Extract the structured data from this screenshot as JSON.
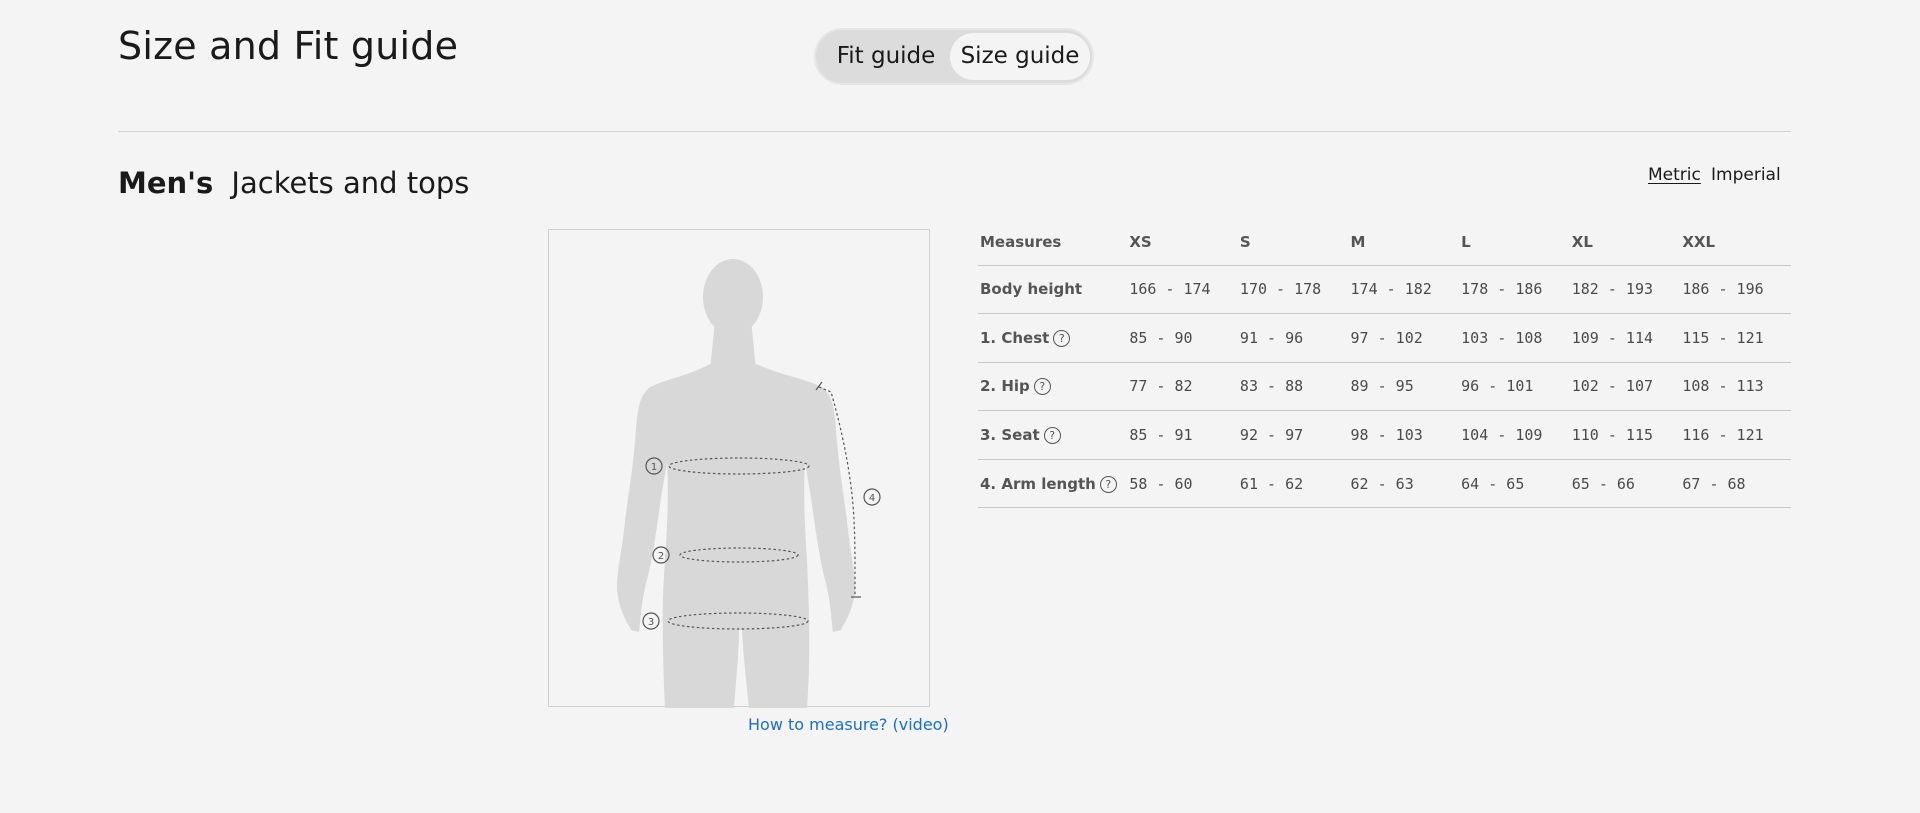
{
  "header": {
    "title": "Size and Fit guide"
  },
  "toggle": {
    "fit_label": "Fit guide",
    "size_label": "Size guide",
    "selected": "Size guide"
  },
  "section": {
    "gender": "Men's",
    "category": "Jackets and tops"
  },
  "units": {
    "metric_label": "Metric",
    "imperial_label": "Imperial",
    "selected": "Metric"
  },
  "figure": {
    "markers": [
      "1",
      "2",
      "3",
      "4"
    ],
    "link_label": "How to measure? (video)"
  },
  "table": {
    "headers": [
      "Measures",
      "XS",
      "S",
      "M",
      "L",
      "XL",
      "XXL"
    ],
    "rows": [
      {
        "label": "Body height",
        "help": false,
        "values": [
          "166 - 174",
          "170 - 178",
          "174 - 182",
          "178 - 186",
          "182 - 193",
          "186 - 196"
        ]
      },
      {
        "label": "1. Chest",
        "help": true,
        "values": [
          "85 - 90",
          "91 - 96",
          "97 - 102",
          "103 - 108",
          "109 - 114",
          "115 - 121"
        ]
      },
      {
        "label": "2. Hip",
        "help": true,
        "values": [
          "77 - 82",
          "83 - 88",
          "89 - 95",
          "96 - 101",
          "102 - 107",
          "108 - 113"
        ]
      },
      {
        "label": "3. Seat",
        "help": true,
        "values": [
          "85 - 91",
          "92 - 97",
          "98 - 103",
          "104 - 109",
          "110 - 115",
          "116 - 121"
        ]
      },
      {
        "label": "4. Arm length",
        "help": true,
        "values": [
          "58 - 60",
          "61 - 62",
          "62 - 63",
          "64 - 65",
          "65 - 66",
          "67 - 68"
        ]
      }
    ],
    "help_glyph": "?"
  },
  "colors": {
    "background": "#f4f4f4",
    "link": "#1a6fc9",
    "silhouette": "#d8d8d8"
  }
}
